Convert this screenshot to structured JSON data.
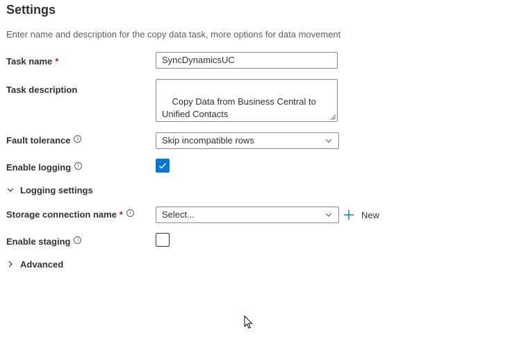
{
  "page": {
    "title": "Settings",
    "subtitle": "Enter name and description for the copy data task, more options for data movement"
  },
  "task_name": {
    "label": "Task name",
    "required_mark": "*",
    "value": "SyncDynamicsUC"
  },
  "task_description": {
    "label": "Task description",
    "value": "Copy Data from Business Central to\nUnified Contacts"
  },
  "fault_tolerance": {
    "label": "Fault tolerance",
    "info_glyph": "i",
    "selected": "Skip incompatible rows"
  },
  "enable_logging": {
    "label": "Enable logging",
    "info_glyph": "i",
    "checked": true
  },
  "logging_settings": {
    "label": "Logging settings",
    "expanded": true
  },
  "storage_connection": {
    "label": "Storage connection name",
    "required_mark": "*",
    "info_glyph": "i",
    "placeholder": "Select...",
    "new_label": "New"
  },
  "enable_staging": {
    "label": "Enable staging",
    "info_glyph": "i",
    "checked": false
  },
  "advanced": {
    "label": "Advanced",
    "expanded": false
  },
  "colors": {
    "accent": "#0078d4",
    "text": "#323130",
    "secondary_text": "#605e5c",
    "required": "#a4262c",
    "border": "#8a8886"
  },
  "icons": {
    "info": "info-icon",
    "chevron_down": "chevron-down-icon",
    "chevron_right": "chevron-right-icon",
    "check": "checkmark-icon",
    "plus": "plus-icon",
    "cursor": "mouse-pointer-icon"
  }
}
